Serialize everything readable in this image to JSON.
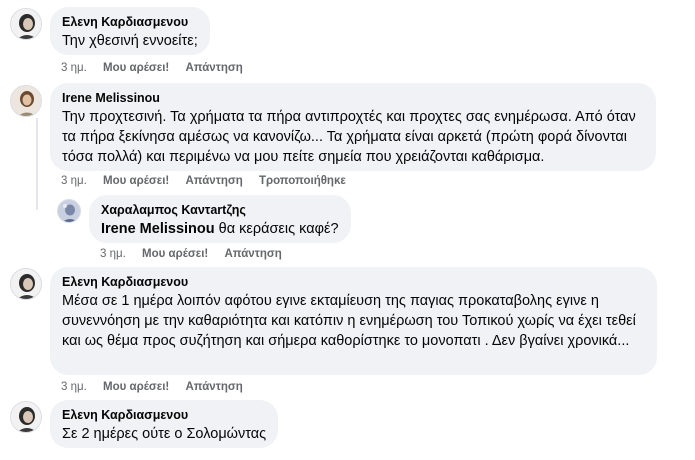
{
  "comments": [
    {
      "author": "Ελενη Καρδιασμενου",
      "text": "Την χθεσινή εννοείτε;",
      "time": "3 ημ.",
      "like": "Μου αρέσει!",
      "reply": "Απάντηση"
    },
    {
      "author": "Irene Melissinou",
      "text": "Την προχτεσινή. Τα χρήματα τα πήρα αντιπροχτές και προχτες σας ενημέρωσα. Από όταν τα πήρα ξεκίνησα αμέσως να κανονίζω... Τα χρήματα είναι αρκετά (πρώτη φορά δίνονται τόσα πολλά) και περιμένω να μου πείτε σημεία που χρειάζονται καθάρισμα.",
      "time": "3 ημ.",
      "like": "Μου αρέσει!",
      "reply": "Απάντηση",
      "edited": "Τροποποιήθηκε"
    },
    {
      "author": "Χαραλαμπος Καντartζης",
      "mention": "Irene Melissinou",
      "text": " θα κεράσεις καφέ?",
      "time": "3 ημ.",
      "like": "Μου αρέσει!",
      "reply": "Απάντηση"
    },
    {
      "author": "Ελενη Καρδιασμενου",
      "text": "Μέσα σε 1 ημέρα λοιπόν αφότου εγινε εκταμίευση της παγιας προκαταβολης εγινε η συνεννόηση με την καθαριότητα και κατόπιν η ενημέρωση του Τοπικού χωρίς να έχει τεθεί και ως θέμα προς συζήτηση και σήμερα καθορίστηκε το μονοπατι . Δεν βγαίνει χρονικά...",
      "time": "3 ημ.",
      "like": "Μου αρέσει!",
      "reply": "Απάντηση"
    },
    {
      "author": "Ελενη Καρδιασμενου",
      "text": "Σε 2 ημέρες ούτε ο Σολομώντας"
    }
  ]
}
